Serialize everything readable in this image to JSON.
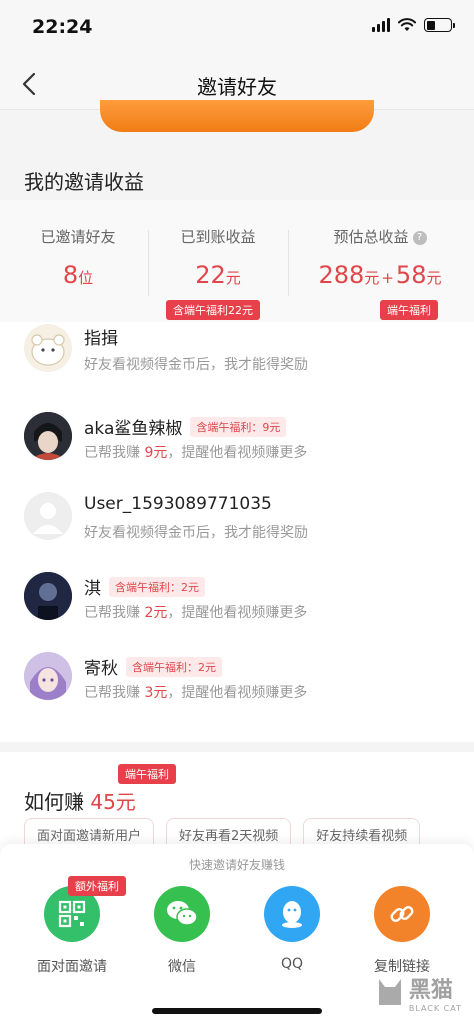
{
  "status_bar": {
    "time": "22:24"
  },
  "nav": {
    "title": "邀请好友"
  },
  "earnings": {
    "section_title": "我的邀请收益",
    "invited_label": "已邀请好友",
    "invited_value": "8",
    "invited_unit": "位",
    "received_label": "已到账收益",
    "received_value": "22",
    "received_unit": "元",
    "received_tag": "含端午福利22元",
    "estimated_label": "预估总收益",
    "estimated_value": "288",
    "estimated_unit": "元",
    "estimated_plus": "+",
    "estimated_bonus": "58",
    "estimated_bonus_unit": "元",
    "estimated_tag": "端午福利",
    "help_glyph": "?"
  },
  "friends": [
    {
      "name": "指揖",
      "sub": "好友看视频得金币后，我才能得奖励",
      "tag": "",
      "amount": ""
    },
    {
      "name": "aka鲨鱼辣椒",
      "tag": "含端午福利：9元",
      "sub_prefix": "已帮我赚 ",
      "amount": "9元",
      "sub_suffix": "，提醒他看视频赚更多"
    },
    {
      "name": "User_1593089771035",
      "sub": "好友看视频得金币后，我才能得奖励",
      "tag": "",
      "amount": ""
    },
    {
      "name": "淇",
      "tag": "含端午福利：2元",
      "sub_prefix": "已帮我赚 ",
      "amount": "2元",
      "sub_suffix": "，提醒他看视频赚更多"
    },
    {
      "name": "寄秋",
      "tag": "含端午福利：2元",
      "sub_prefix": "已帮我赚 ",
      "amount": "3元",
      "sub_suffix": "，提醒他看视频赚更多"
    }
  ],
  "how": {
    "tag": "端午福利",
    "title_prefix": "如何赚 ",
    "title_amount": "45元",
    "chips": [
      "面对面邀请新用户",
      "好友再看2天视频",
      "好友持续看视频"
    ]
  },
  "share": {
    "title": "快速邀请好友赚钱",
    "extra_tag": "额外福利",
    "items": [
      {
        "label": "面对面邀请",
        "icon": "qr-code-icon",
        "color": "#34c06a"
      },
      {
        "label": "微信",
        "icon": "wechat-icon",
        "color": "#36c04f"
      },
      {
        "label": "QQ",
        "icon": "qq-icon",
        "color": "#31a6f2"
      },
      {
        "label": "复制链接",
        "icon": "link-icon",
        "color": "#f3832a"
      }
    ]
  },
  "watermark": {
    "text": "黑猫",
    "sub": "BLACK CAT"
  },
  "colors": {
    "accent_red": "#e0464a",
    "orange": "#f07d15"
  }
}
